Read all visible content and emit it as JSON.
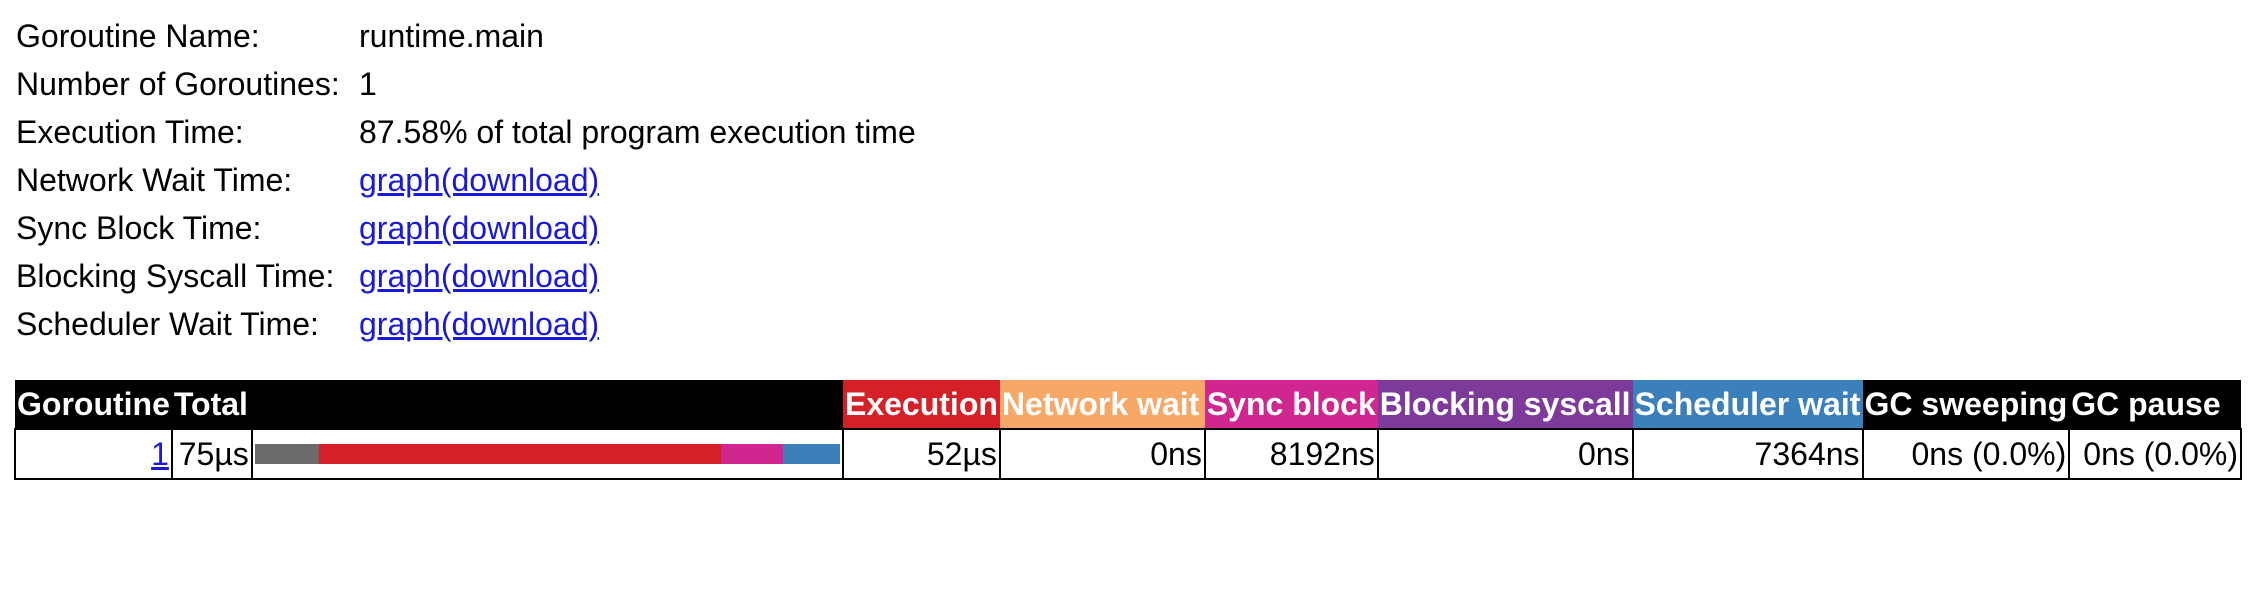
{
  "summary": [
    {
      "label": "Goroutine Name:",
      "value": "runtime.main",
      "is_link": false
    },
    {
      "label": "Number of Goroutines:",
      "value": "1",
      "is_link": false
    },
    {
      "label": "Execution Time:",
      "value": "87.58% of total program execution time",
      "is_link": false
    },
    {
      "label": "Network Wait Time:",
      "value": "graph(download)",
      "is_link": true
    },
    {
      "label": "Sync Block Time:",
      "value": "graph(download)",
      "is_link": true
    },
    {
      "label": "Blocking Syscall Time:",
      "value": "graph(download)",
      "is_link": true
    },
    {
      "label": "Scheduler Wait Time:",
      "value": "graph(download)",
      "is_link": true
    }
  ],
  "table": {
    "headers": {
      "goroutine": "Goroutine",
      "total": "Total",
      "execution": "Execution",
      "network_wait": "Network wait",
      "sync_block": "Sync block",
      "blocking_syscall": "Blocking syscall",
      "scheduler_wait": "Scheduler wait",
      "gc_sweeping": "GC sweeping",
      "gc_pause": "GC pause"
    },
    "header_colors": {
      "default": "#000000",
      "execution": "#d62028",
      "network_wait": "#f7a866",
      "sync_block": "#d0268f",
      "blocking_syscall": "#7e3a9b",
      "scheduler_wait": "#3b80bb"
    },
    "row": {
      "goroutine": "1",
      "total": "75µs",
      "execution": "52µs",
      "network_wait": "0ns",
      "sync_block": "8192ns",
      "blocking_syscall": "0ns",
      "scheduler_wait": "7364ns",
      "gc_sweeping": "0ns (0.0%)",
      "gc_pause": "0ns (0.0%)"
    },
    "breakdown_bar": [
      {
        "segment": "other",
        "fraction": 0.11,
        "color": "#6b6b6b"
      },
      {
        "segment": "execution",
        "fraction": 0.69,
        "color": "#d62028"
      },
      {
        "segment": "sync_block",
        "fraction": 0.107,
        "color": "#d0268f"
      },
      {
        "segment": "scheduler_wait",
        "fraction": 0.098,
        "color": "#3b80bb"
      }
    ]
  }
}
